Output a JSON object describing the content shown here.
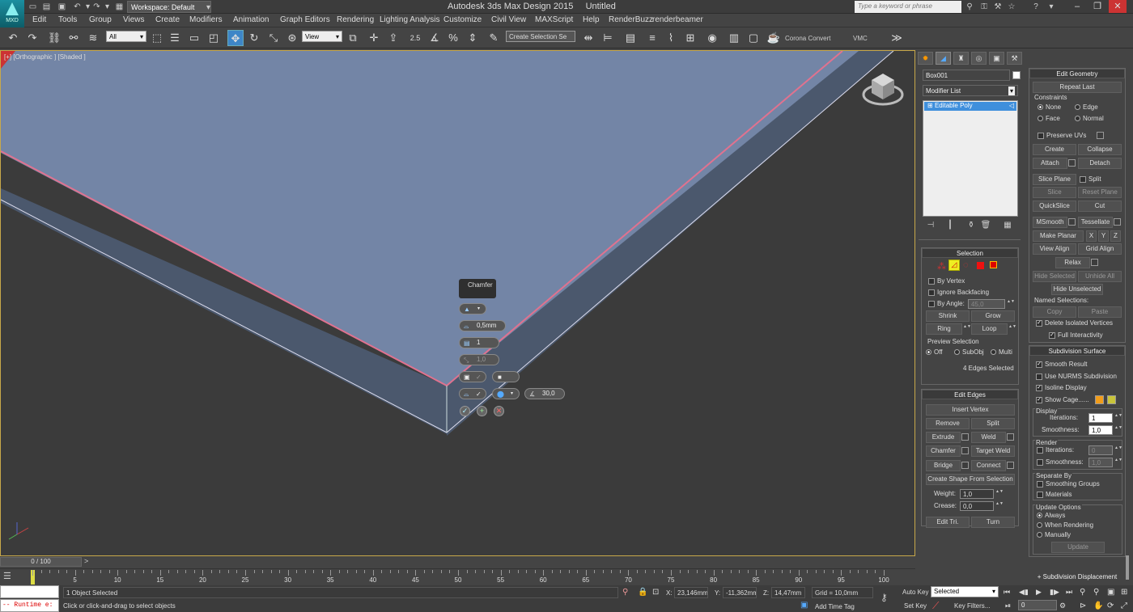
{
  "title_bar": {
    "app_logo_text": "MXD",
    "workspace": "Workspace: Default",
    "title": "Autodesk 3ds Max Design 2015",
    "document": "Untitled",
    "search_placeholder": "Type a keyword or phrase"
  },
  "menu": [
    "Edit",
    "Tools",
    "Group",
    "Views",
    "Create",
    "Modifiers",
    "Animation",
    "Graph Editors",
    "Rendering",
    "Lighting Analysis",
    "Customize",
    "Civil View",
    "MAXScript",
    "Help",
    "RenderBuzz",
    "renderbeamer"
  ],
  "toolbar": {
    "selection_filter": "All",
    "coord_system": "View",
    "snap_label": "2.5",
    "named_selection": "Create Selection Se",
    "corona_label": "Corona Convert",
    "vmc_label": "VMC"
  },
  "viewport": {
    "label": "[+] [Orthographic ] [Shaded ]",
    "colors": {
      "top_face": "#7385a6",
      "side_face": "#4b586d",
      "background": "#3b3b3b",
      "selected_edge": "#e0728f",
      "border": "#c8a84a"
    }
  },
  "chamfer_caddy": {
    "title": "Chamfer",
    "amount": "0,5mm",
    "segments": "1",
    "tension": "1,0",
    "angle": "30,0"
  },
  "command_panel": {
    "object_name": "Box001",
    "modifier_list": "Modifier List",
    "stack_item": "Editable Poly",
    "selection": {
      "header": "Selection",
      "by_vertex": "By Vertex",
      "ignore_backfacing": "Ignore Backfacing",
      "by_angle": "By Angle:",
      "by_angle_value": "45,0",
      "shrink": "Shrink",
      "grow": "Grow",
      "ring": "Ring",
      "loop": "Loop",
      "preview_title": "Preview Selection",
      "preview_off": "Off",
      "preview_subobj": "SubObj",
      "preview_multi": "Multi",
      "status": "4 Edges Selected"
    },
    "edit_edges": {
      "header": "Edit Edges",
      "insert_vertex": "Insert Vertex",
      "remove": "Remove",
      "split": "Split",
      "extrude": "Extrude",
      "weld": "Weld",
      "chamfer": "Chamfer",
      "target_weld": "Target Weld",
      "bridge": "Bridge",
      "connect": "Connect",
      "create_shape": "Create Shape From Selection",
      "weight_label": "Weight:",
      "weight_value": "1,0",
      "crease_label": "Crease:",
      "crease_value": "0,0",
      "edit_tri": "Edit Tri.",
      "turn": "Turn"
    },
    "edit_geometry": {
      "header": "Edit Geometry",
      "repeat_last": "Repeat Last",
      "constraints": "Constraints",
      "none": "None",
      "edge": "Edge",
      "face": "Face",
      "normal": "Normal",
      "preserve_uvs": "Preserve UVs",
      "create": "Create",
      "collapse": "Collapse",
      "attach": "Attach",
      "detach": "Detach",
      "slice_plane": "Slice Plane",
      "split": "Split",
      "slice": "Slice",
      "reset_plane": "Reset Plane",
      "quickslice": "QuickSlice",
      "cut": "Cut",
      "msmooth": "MSmooth",
      "tessellate": "Tessellate",
      "make_planar": "Make Planar",
      "x": "X",
      "y": "Y",
      "z": "Z",
      "view_align": "View Align",
      "grid_align": "Grid Align",
      "relax": "Relax",
      "hide_selected": "Hide Selected",
      "unhide_all": "Unhide All",
      "hide_unselected": "Hide Unselected",
      "named_selections": "Named Selections:",
      "copy": "Copy",
      "paste": "Paste",
      "delete_isolated": "Delete Isolated Vertices",
      "full_interactivity": "Full Interactivity"
    },
    "subdivision_surface": {
      "header": "Subdivision Surface",
      "smooth_result": "Smooth Result",
      "use_nurms": "Use NURMS Subdivision",
      "isoline_display": "Isoline Display",
      "show_cage": "Show Cage......",
      "display": "Display",
      "iterations_label": "Iterations:",
      "iterations_value": "1",
      "smoothness_label": "Smoothness:",
      "smoothness_value": "1,0",
      "render": "Render",
      "render_iterations_value": "0",
      "render_smoothness_value": "1,0",
      "separate_by": "Separate By",
      "smoothing_groups": "Smoothing Groups",
      "materials": "Materials",
      "update_options": "Update Options",
      "always": "Always",
      "when_rendering": "When Rendering",
      "manually": "Manually",
      "update": "Update",
      "cage_color1": "#f29d1a",
      "cage_color2": "#c9c43a"
    },
    "subdivision_displacement": "Subdivision Displacement"
  },
  "timeline": {
    "frame": "0 / 100",
    "ticks": [
      "0",
      "5",
      "10",
      "15",
      "20",
      "25",
      "30",
      "35",
      "40",
      "45",
      "50",
      "55",
      "60",
      "65",
      "70",
      "75",
      "80",
      "85",
      "90",
      "95",
      "100"
    ]
  },
  "status": {
    "maxscript": "-- Runtime e:",
    "objects_selected": "1 Object Selected",
    "prompt": "Click or click-and-drag to select objects",
    "x_label": "X:",
    "x_value": "23,146mm",
    "y_label": "Y:",
    "y_value": "-11,362mm",
    "z_label": "Z:",
    "z_value": "14,47mm",
    "grid": "Grid = 10,0mm",
    "add_time_tag": "Add Time Tag",
    "auto_key": "Auto Key",
    "set_key": "Set Key",
    "key_mode": "Selected",
    "key_filters": "Key Filters...",
    "current_frame": "0"
  }
}
